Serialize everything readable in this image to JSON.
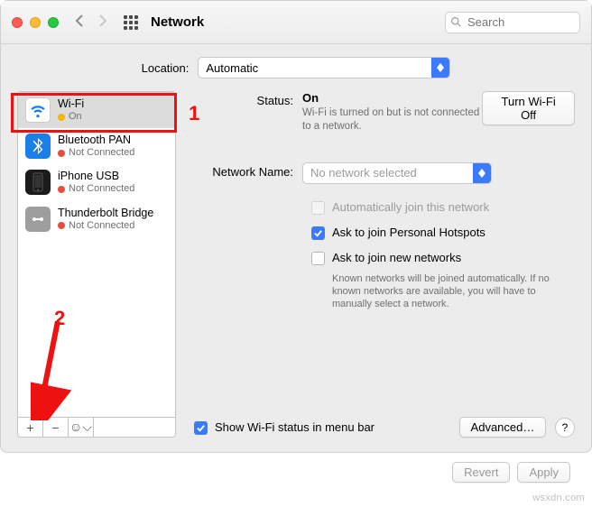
{
  "window": {
    "title": "Network"
  },
  "search": {
    "placeholder": "Search"
  },
  "location": {
    "label": "Location:",
    "value": "Automatic"
  },
  "services": [
    {
      "name": "Wi-Fi",
      "status": "On",
      "dot": "y",
      "selected": true
    },
    {
      "name": "Bluetooth PAN",
      "status": "Not Connected",
      "dot": "r",
      "selected": false
    },
    {
      "name": "iPhone USB",
      "status": "Not Connected",
      "dot": "r",
      "selected": false
    },
    {
      "name": "Thunderbolt Bridge",
      "status": "Not Connected",
      "dot": "r",
      "selected": false
    }
  ],
  "sidebar_tools": {
    "add": "+",
    "remove": "−",
    "menu": "☺︎⌵"
  },
  "details": {
    "status_label": "Status:",
    "status_value": "On",
    "status_sub": "Wi-Fi is turned on but is not connected to a network.",
    "toggle_button": "Turn Wi-Fi Off",
    "network_name_label": "Network Name:",
    "network_name_value": "No network selected",
    "auto_join": "Automatically join this network",
    "personal_hotspots": "Ask to join Personal Hotspots",
    "ask_new": "Ask to join new networks",
    "ask_new_sub": "Known networks will be joined automatically. If no known networks are available, you will have to manually select a network.",
    "show_menubar": "Show Wi-Fi status in menu bar",
    "advanced": "Advanced…",
    "help": "?"
  },
  "footer": {
    "revert": "Revert",
    "apply": "Apply"
  },
  "annotations": {
    "one": "1",
    "two": "2"
  },
  "watermark": "wsxdn.com"
}
